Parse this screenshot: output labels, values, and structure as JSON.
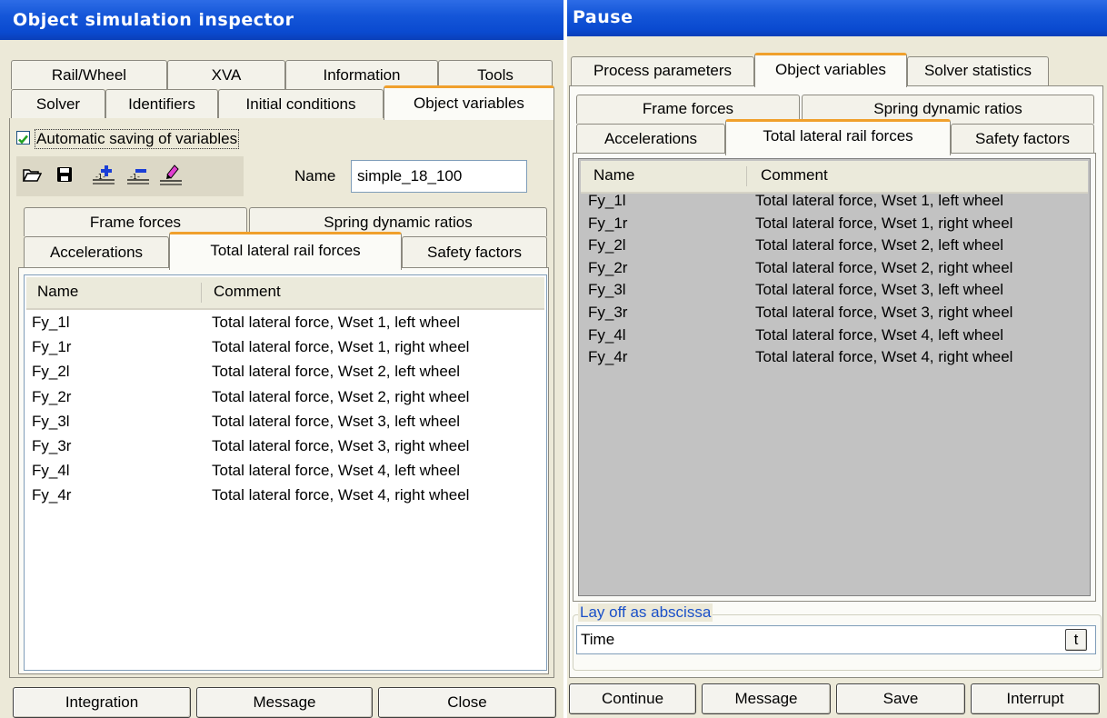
{
  "left": {
    "title": "Object simulation inspector",
    "tabs_row1": [
      "Rail/Wheel",
      "XVA",
      "Information",
      "Tools"
    ],
    "tabs_row2": [
      "Solver",
      "Identifiers",
      "Initial conditions",
      "Object variables"
    ],
    "autosave_label": "Automatic saving of variables",
    "autosave_checked": true,
    "name_label": "Name",
    "name_value": "simple_18_100",
    "subtabs_row1": [
      "Frame forces",
      "Spring dynamic ratios"
    ],
    "subtabs_row2": [
      "Accelerations",
      "Total lateral rail forces",
      "Safety factors"
    ],
    "buttons": [
      "Integration",
      "Message",
      "Close"
    ]
  },
  "right": {
    "title": "Pause",
    "tabs": [
      "Process parameters",
      "Object variables",
      "Solver statistics"
    ],
    "subtabs_row1": [
      "Frame forces",
      "Spring dynamic ratios"
    ],
    "subtabs_row2": [
      "Accelerations",
      "Total lateral rail forces",
      "Safety factors"
    ],
    "abscissa_label": "Lay off as abscissa",
    "abscissa_value": "Time",
    "abscissa_button": "t",
    "buttons": [
      "Continue",
      "Message",
      "Save",
      "Interrupt"
    ]
  },
  "table": {
    "col_name": "Name",
    "col_comment": "Comment",
    "rows": [
      {
        "name": "Fy_1l",
        "comment": "Total lateral force, Wset 1, left wheel"
      },
      {
        "name": "Fy_1r",
        "comment": "Total lateral force, Wset 1, right wheel"
      },
      {
        "name": "Fy_2l",
        "comment": "Total lateral force, Wset 2, left wheel"
      },
      {
        "name": "Fy_2r",
        "comment": "Total lateral force, Wset 2, right wheel"
      },
      {
        "name": "Fy_3l",
        "comment": "Total lateral force, Wset 3, left wheel"
      },
      {
        "name": "Fy_3r",
        "comment": "Total lateral force, Wset 3, right wheel"
      },
      {
        "name": "Fy_4l",
        "comment": "Total lateral force, Wset 4, left wheel"
      },
      {
        "name": "Fy_4r",
        "comment": "Total lateral force, Wset 4, right wheel"
      }
    ]
  },
  "icons": [
    "open-folder-icon",
    "save-icon",
    "add-variable-icon",
    "remove-variable-icon",
    "edit-variable-icon"
  ],
  "colors": {
    "titlebar": "#0a4ad0",
    "active_tab_accent": "#f0a02c",
    "checkbox_green": "#21a121",
    "list_gray": "#c2c2c2"
  }
}
